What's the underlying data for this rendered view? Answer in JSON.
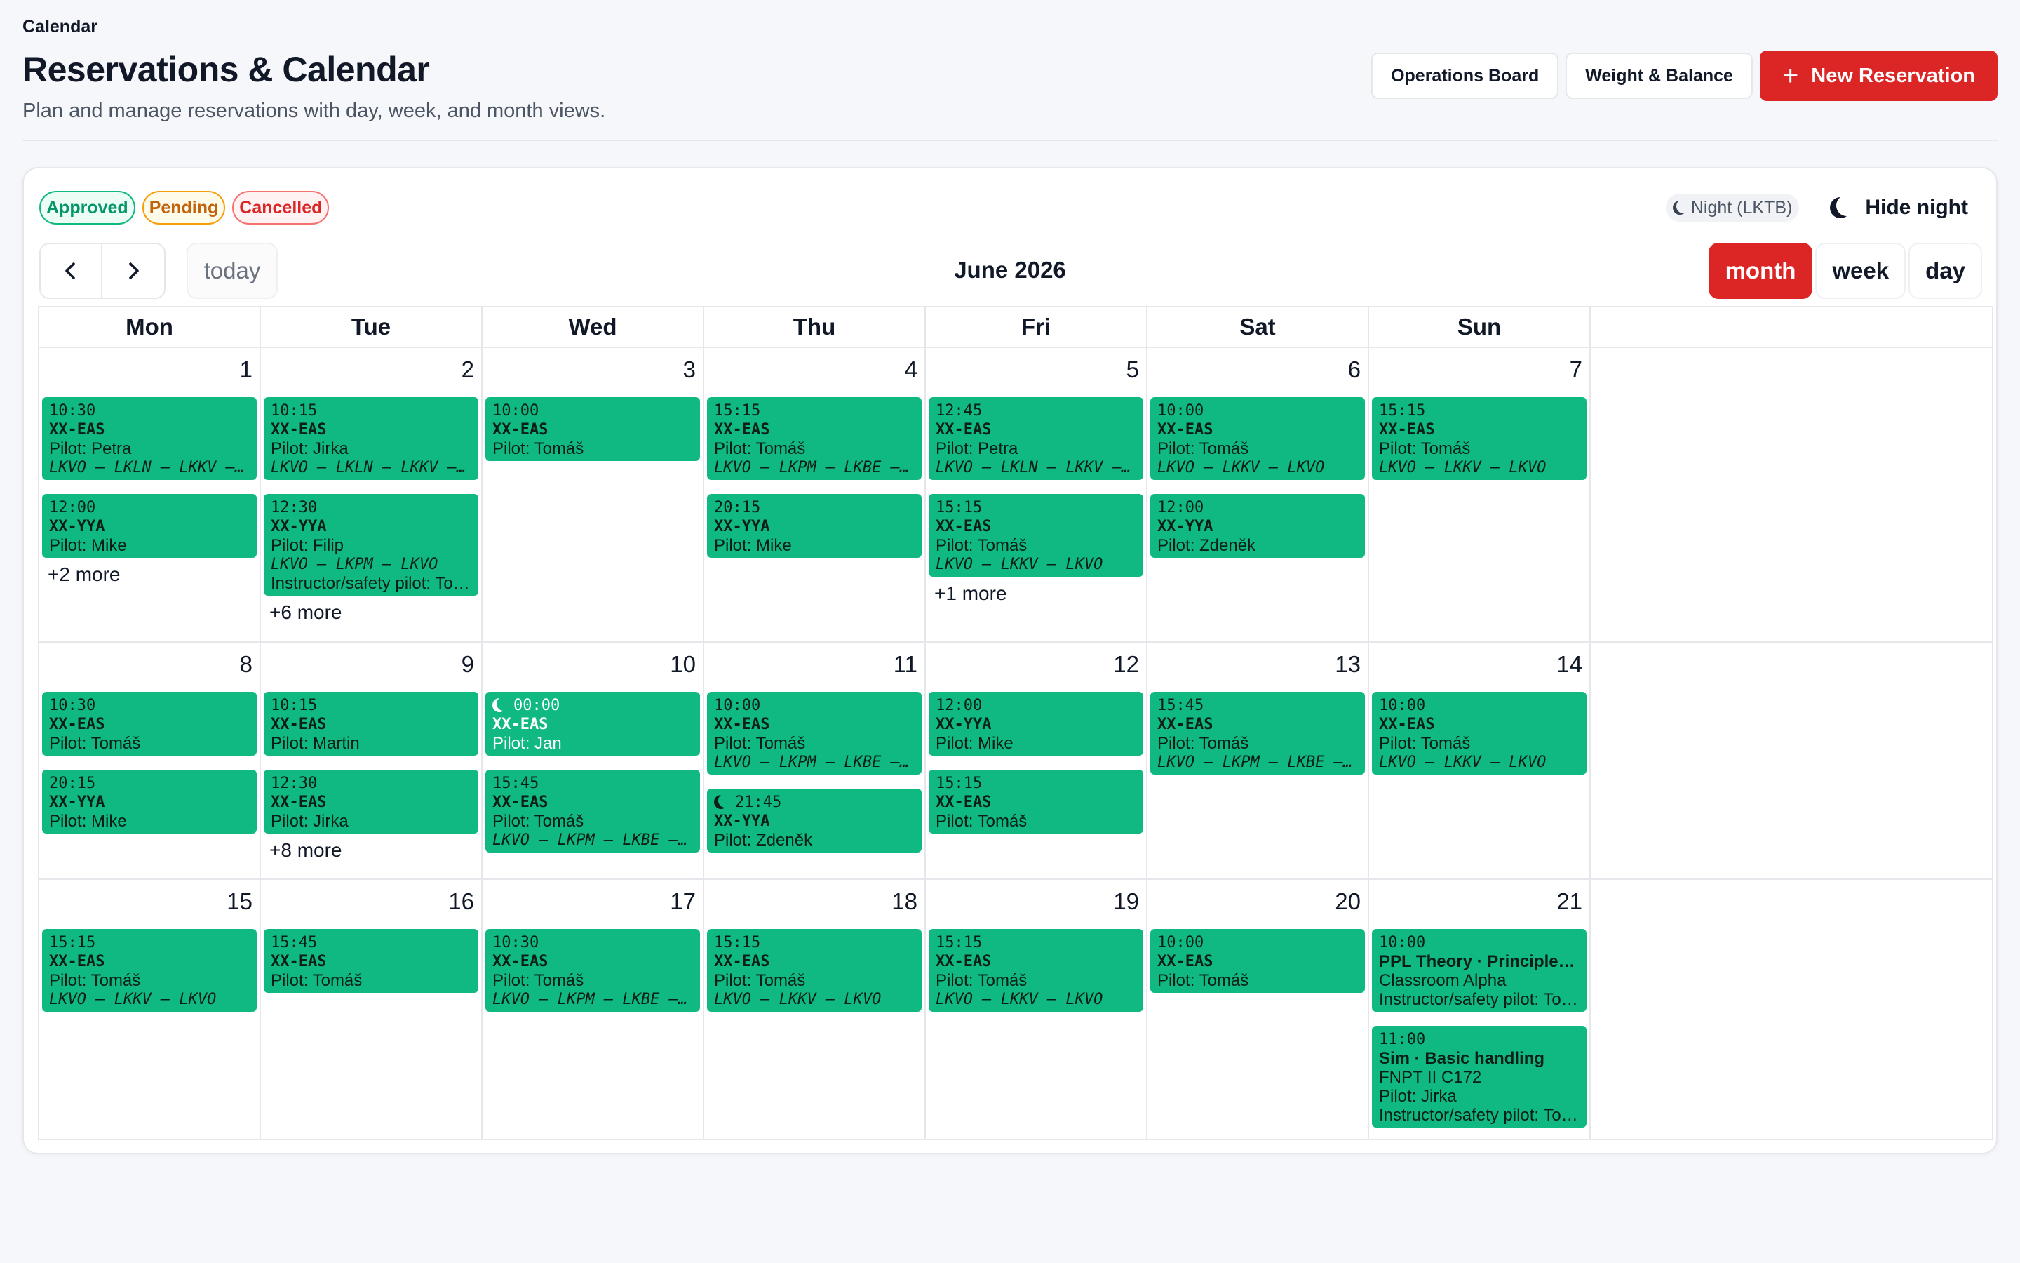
{
  "breadcrumb": "Calendar",
  "title": "Reservations & Calendar",
  "subtitle": "Plan and manage reservations with day, week, and month views.",
  "actions": {
    "operations_board": "Operations Board",
    "weight_balance": "Weight & Balance",
    "new_reservation": "New Reservation"
  },
  "legend": {
    "approved": "Approved",
    "pending": "Pending",
    "cancelled": "Cancelled"
  },
  "night": {
    "badge": "Night (LKTB)",
    "toggle": "Hide night"
  },
  "toolbar": {
    "today": "today",
    "month_label": "June 2026",
    "views": [
      "month",
      "week",
      "day"
    ],
    "active_view": "month"
  },
  "colors": {
    "event_green": "#10b981",
    "accent_red": "#dc2626"
  },
  "weekdays": [
    "Mon",
    "Tue",
    "Wed",
    "Thu",
    "Fri",
    "Sat",
    "Sun"
  ],
  "weeks": [
    {
      "days": [
        {
          "num": "1",
          "events": [
            {
              "time": "10:30",
              "aircraft": "XX-EAS",
              "pilot": "Pilot: Petra",
              "route": "LKVO – LKLN – LKKV – LKVO"
            },
            {
              "time": "12:00",
              "aircraft": "XX-YYA",
              "pilot": "Pilot: Mike"
            }
          ],
          "more": "+2 more"
        },
        {
          "num": "2",
          "events": [
            {
              "time": "10:15",
              "aircraft": "XX-EAS",
              "pilot": "Pilot: Jirka",
              "route": "LKVO – LKLN – LKKV – LKVO"
            },
            {
              "time": "12:30",
              "aircraft": "XX-YYA",
              "pilot": "Pilot: Filip",
              "route": "LKVO – LKPM – LKVO",
              "extra": "Instructor/safety pilot: Tomáš"
            }
          ],
          "more": "+6 more"
        },
        {
          "num": "3",
          "events": [
            {
              "time": "10:00",
              "aircraft": "XX-EAS",
              "pilot": "Pilot: Tomáš"
            }
          ]
        },
        {
          "num": "4",
          "events": [
            {
              "time": "15:15",
              "aircraft": "XX-EAS",
              "pilot": "Pilot: Tomáš",
              "route": "LKVO – LKPM – LKBE – LKVO"
            },
            {
              "time": "20:15",
              "aircraft": "XX-YYA",
              "pilot": "Pilot: Mike"
            }
          ]
        },
        {
          "num": "5",
          "events": [
            {
              "time": "12:45",
              "aircraft": "XX-EAS",
              "pilot": "Pilot: Petra",
              "route": "LKVO – LKLN – LKKV – LKVO"
            },
            {
              "time": "15:15",
              "aircraft": "XX-EAS",
              "pilot": "Pilot: Tomáš",
              "route": "LKVO – LKKV – LKVO"
            }
          ],
          "more": "+1 more"
        },
        {
          "num": "6",
          "events": [
            {
              "time": "10:00",
              "aircraft": "XX-EAS",
              "pilot": "Pilot: Tomáš",
              "route": "LKVO – LKKV – LKVO"
            },
            {
              "time": "12:00",
              "aircraft": "XX-YYA",
              "pilot": "Pilot: Zdeněk"
            }
          ]
        },
        {
          "num": "7",
          "events": [
            {
              "time": "15:15",
              "aircraft": "XX-EAS",
              "pilot": "Pilot: Tomáš",
              "route": "LKVO – LKKV – LKVO"
            }
          ]
        }
      ]
    },
    {
      "days": [
        {
          "num": "8",
          "events": [
            {
              "time": "10:30",
              "aircraft": "XX-EAS",
              "pilot": "Pilot: Tomáš"
            },
            {
              "time": "20:15",
              "aircraft": "XX-YYA",
              "pilot": "Pilot: Mike"
            }
          ]
        },
        {
          "num": "9",
          "events": [
            {
              "time": "10:15",
              "aircraft": "XX-EAS",
              "pilot": "Pilot: Martin"
            },
            {
              "time": "12:30",
              "aircraft": "XX-EAS",
              "pilot": "Pilot: Jirka"
            }
          ],
          "more": "+8 more"
        },
        {
          "num": "10",
          "events": [
            {
              "time": "00:00",
              "aircraft": "XX-EAS",
              "pilot": "Pilot: Jan",
              "night": true
            },
            {
              "time": "15:45",
              "aircraft": "XX-EAS",
              "pilot": "Pilot: Tomáš",
              "route": "LKVO – LKPM – LKBE – LKVO"
            }
          ]
        },
        {
          "num": "11",
          "events": [
            {
              "time": "10:00",
              "aircraft": "XX-EAS",
              "pilot": "Pilot: Tomáš",
              "route": "LKVO – LKPM – LKBE – LKVO"
            },
            {
              "time": "21:45",
              "aircraft": "XX-YYA",
              "pilot": "Pilot: Zdeněk",
              "night_icon": true
            }
          ]
        },
        {
          "num": "12",
          "events": [
            {
              "time": "12:00",
              "aircraft": "XX-YYA",
              "pilot": "Pilot: Mike"
            },
            {
              "time": "15:15",
              "aircraft": "XX-EAS",
              "pilot": "Pilot: Tomáš"
            }
          ]
        },
        {
          "num": "13",
          "events": [
            {
              "time": "15:45",
              "aircraft": "XX-EAS",
              "pilot": "Pilot: Tomáš",
              "route": "LKVO – LKPM – LKBE – LKVO"
            }
          ]
        },
        {
          "num": "14",
          "events": [
            {
              "time": "10:00",
              "aircraft": "XX-EAS",
              "pilot": "Pilot: Tomáš",
              "route": "LKVO – LKKV – LKVO"
            }
          ]
        }
      ]
    },
    {
      "days": [
        {
          "num": "15",
          "events": [
            {
              "time": "15:15",
              "aircraft": "XX-EAS",
              "pilot": "Pilot: Tomáš",
              "route": "LKVO – LKKV – LKVO"
            }
          ]
        },
        {
          "num": "16",
          "events": [
            {
              "time": "15:45",
              "aircraft": "XX-EAS",
              "pilot": "Pilot: Tomáš"
            }
          ]
        },
        {
          "num": "17",
          "events": [
            {
              "time": "10:30",
              "aircraft": "XX-EAS",
              "pilot": "Pilot: Tomáš",
              "route": "LKVO – LKPM – LKBE – LKVO"
            }
          ]
        },
        {
          "num": "18",
          "events": [
            {
              "time": "15:15",
              "aircraft": "XX-EAS",
              "pilot": "Pilot: Tomáš",
              "route": "LKVO – LKKV – LKVO"
            }
          ]
        },
        {
          "num": "19",
          "events": [
            {
              "time": "15:15",
              "aircraft": "XX-EAS",
              "pilot": "Pilot: Tomáš",
              "route": "LKVO – LKKV – LKVO"
            }
          ]
        },
        {
          "num": "20",
          "events": [
            {
              "time": "10:00",
              "aircraft": "XX-EAS",
              "pilot": "Pilot: Tomáš"
            }
          ]
        },
        {
          "num": "21",
          "events": [
            {
              "time": "10:00",
              "title": "PPL Theory · Principles of Flight",
              "location": "Classroom Alpha",
              "extra": "Instructor/safety pilot: Tomáš"
            },
            {
              "time": "11:00",
              "title": "Sim · Basic handling",
              "location": "FNPT II C172",
              "pilot": "Pilot: Jirka",
              "extra": "Instructor/safety pilot: Tomáš"
            }
          ]
        }
      ]
    }
  ]
}
